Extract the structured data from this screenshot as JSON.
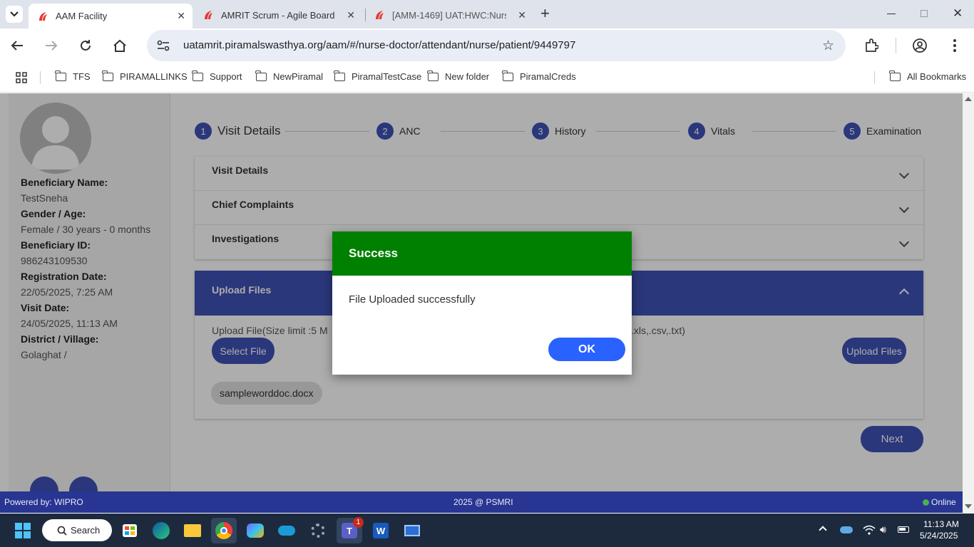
{
  "browser": {
    "tabs": [
      {
        "title": "AAM Facility",
        "active": true
      },
      {
        "title": "AMRIT Scrum - Agile Board",
        "active": false
      },
      {
        "title": "[AMM-1469] UAT:HWC:Nurs",
        "active": false
      }
    ],
    "new_tab_symbol": "+",
    "url": "uatamrit.piramalswasthya.org/aam/#/nurse-doctor/attendant/nurse/patient/9449797",
    "bookmarks": [
      "TFS",
      "PIRAMALLINKS",
      "Support",
      "NewPiramal",
      "PiramalTestCase",
      "New folder",
      "PiramalCreds"
    ],
    "all_bookmarks": "All Bookmarks"
  },
  "patient": {
    "name_label": "Beneficiary Name:",
    "name": "TestSneha",
    "gender_age_label": "Gender / Age:",
    "gender_age": "Female / 30 years - 0 months",
    "id_label": "Beneficiary ID:",
    "id": "986243109530",
    "reg_date_label": "Registration Date:",
    "reg_date": "22/05/2025, 7:25 AM",
    "visit_date_label": "Visit Date:",
    "visit_date": "24/05/2025, 11:13 AM",
    "district_label": "District / Village:",
    "district": "Golaghat /"
  },
  "stepper": [
    {
      "num": "1",
      "label": "Visit Details"
    },
    {
      "num": "2",
      "label": "ANC"
    },
    {
      "num": "3",
      "label": "History"
    },
    {
      "num": "4",
      "label": "Vitals"
    },
    {
      "num": "5",
      "label": "Examination"
    }
  ],
  "accordion": {
    "visit_details": "Visit Details",
    "chief_complaints": "Chief Complaints",
    "investigations": "Investigations"
  },
  "upload": {
    "header": "Upload Files",
    "hint_left": "Upload File(Size limit :5 M",
    "hint_right": ".xls,.csv,.txt)",
    "select_file": "Select File",
    "upload_button": "Upload Files",
    "file_chip": "sampleworddoc.docx"
  },
  "next_button": "Next",
  "dialog": {
    "title": "Success",
    "message": "File Uploaded successfully",
    "ok": "OK"
  },
  "footer": {
    "powered_by": "Powered by: WIPRO",
    "copyright": "2025 @ PSMRI",
    "status": "Online"
  },
  "taskbar": {
    "search": "Search",
    "teams_badge": "1",
    "time": "11:13 AM",
    "date": "5/24/2025"
  },
  "colors": {
    "primary": "#3f51b5",
    "success_header": "#008000",
    "ok_button": "#2962ff",
    "footer": "#283593"
  }
}
